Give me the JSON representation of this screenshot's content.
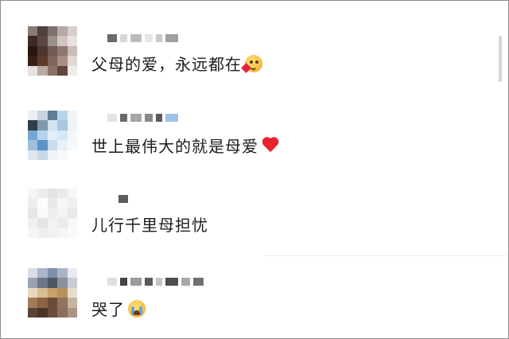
{
  "comments": [
    {
      "text": "父母的爱，永远都在",
      "emoji": "kiss-heart-face-emoji",
      "avatar_colors": [
        "#8b7a74",
        "#4d4140",
        "#7f7070",
        "#b7aaa6",
        "#d7d0ce",
        "#3e2b27",
        "#5a4743",
        "#9d8d88",
        "#cfc6c2",
        "#e8e3e1",
        "#27150f",
        "#4d3630",
        "#6f5a54",
        "#8e7770",
        "#cbbcb6",
        "#3a1f16",
        "#5c3b2e",
        "#826357",
        "#a88e85",
        "#e2d8d4",
        "#e6e1df",
        "#bba8a1",
        "#8a7168",
        "#5f463d",
        "#efebea"
      ],
      "name_blur_colors": [
        "#6b6b6b",
        "#d9d9d9",
        "#bdbdbd",
        "#e6e6e6",
        "#c9c9c9",
        "#a0a0a0"
      ]
    },
    {
      "text": "世上最伟大的就是母爱",
      "emoji": "red-heart-emoji",
      "avatar_colors": [
        "#e9eef3",
        "#c6d4df",
        "#5f7d95",
        "#b8d4ea",
        "#f1f4f7",
        "#2f3f4b",
        "#7f99ae",
        "#d3e3f0",
        "#a7c7e3",
        "#eef3f8",
        "#74a6d1",
        "#b5d2ec",
        "#e2eef8",
        "#d6e7f5",
        "#f3f7fb",
        "#9ebfdc",
        "#5a93c7",
        "#c7ddef",
        "#e9f1f8",
        "#f6f9fc",
        "#dfe7ee",
        "#c7d8e6",
        "#f0f4f8",
        "#f7f9fb",
        "#ffffff"
      ],
      "name_blur_colors": [
        "#e3e3e3",
        "#6b6b6b",
        "#a6a6a6",
        "#888888",
        "#5a5a5a",
        "#9ec1ea"
      ]
    },
    {
      "text": "儿行千里母担忧",
      "emoji": "",
      "avatar_colors": [
        "#f4f4f4",
        "#ececec",
        "#e3e3e3",
        "#eaeaea",
        "#f6f6f6",
        "#ededed",
        "#fbfbfb",
        "#e8e8e8",
        "#f7f7f7",
        "#efefef",
        "#e6e6e6",
        "#f9f9f9",
        "#eeeeee",
        "#f3f3f3",
        "#e9e9e9",
        "#f0f0f0",
        "#e5e5e5",
        "#f2f2f2",
        "#ebebeb",
        "#f8f8f8",
        "#f5f5f5",
        "#efefef",
        "#f1f1f1",
        "#f6f6f6",
        "#fafafa"
      ],
      "name_blur_colors": [
        "#5c5c5c"
      ]
    },
    {
      "text": "哭了",
      "emoji": "crying-face-emoji",
      "avatar_colors": [
        "#d9dde6",
        "#aab6c9",
        "#7d8faa",
        "#a9b3c4",
        "#e8eaef",
        "#9aa2b0",
        "#6d7687",
        "#4f5666",
        "#8a8f99",
        "#c8ccd3",
        "#e5d7c4",
        "#d9bd93",
        "#c9a06b",
        "#b98f5c",
        "#e7dccc",
        "#a27a55",
        "#8a6444",
        "#6b4c35",
        "#8e7460",
        "#c6b3a2",
        "#5b4334",
        "#4a3528",
        "#6a4e3c",
        "#8b6f5c",
        "#ad9382"
      ],
      "name_blur_colors": [
        "#e0e0e0",
        "#444444",
        "#9a9a9a",
        "#5a5a5a",
        "#c4c4c4",
        "#4d4d4d",
        "#a8a8a8",
        "#707070"
      ]
    }
  ]
}
